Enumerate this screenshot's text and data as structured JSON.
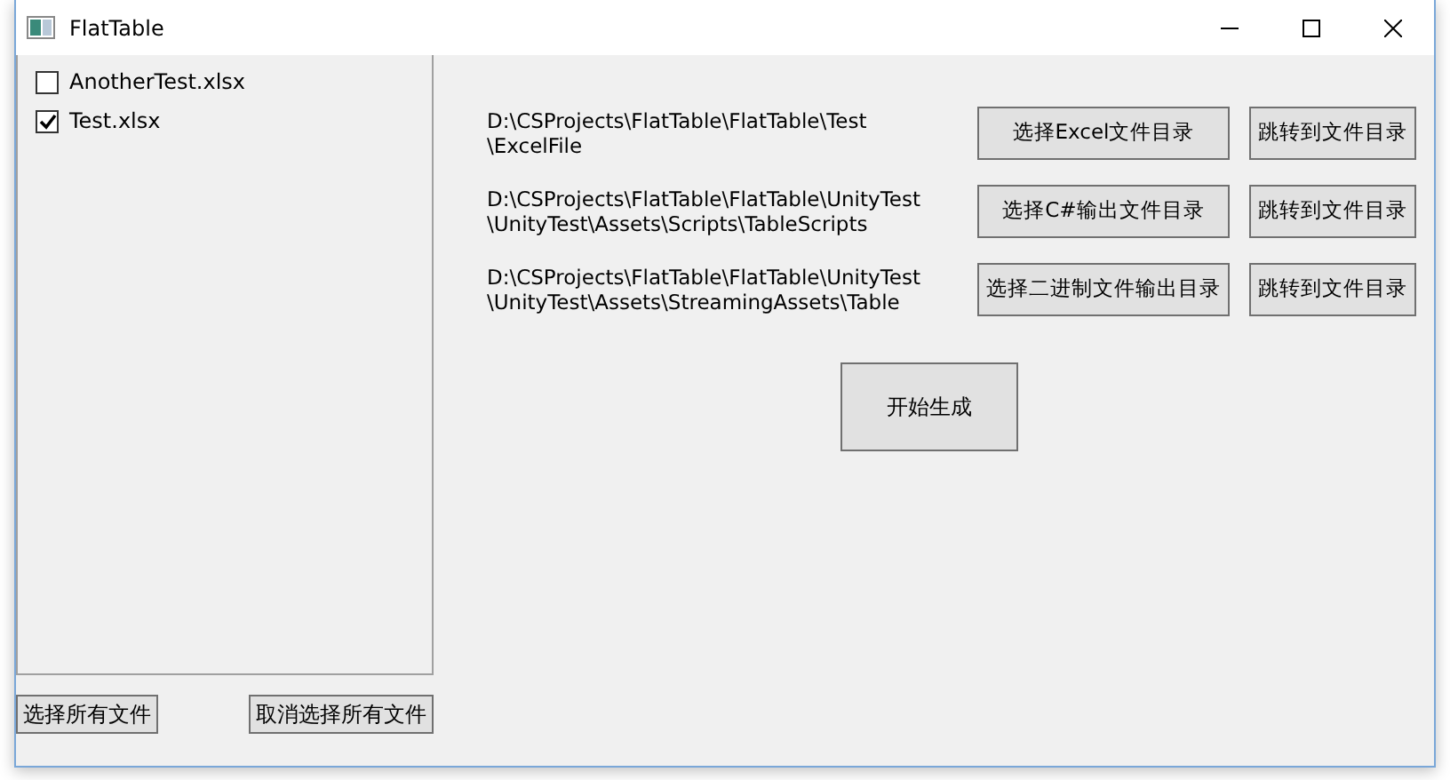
{
  "window": {
    "title": "FlatTable"
  },
  "files": [
    {
      "name": "AnotherTest.xlsx",
      "checked": false
    },
    {
      "name": "Test.xlsx",
      "checked": true
    }
  ],
  "file_buttons": [
    "选择所有文件",
    "取消选择所有文件"
  ],
  "directories": [
    {
      "path": "D:\\CSProjects\\FlatTable\\FlatTable\\Test\n\\ExcelFile",
      "choose": "选择Excel文件目录",
      "open": "跳转到文件目录"
    },
    {
      "path": "D:\\CSProjects\\FlatTable\\FlatTable\\UnityTest\n\\UnityTest\\Assets\\Scripts\\TableScripts",
      "choose": "选择C#输出文件目录",
      "open": "跳转到文件目录"
    },
    {
      "path": "D:\\CSProjects\\FlatTable\\FlatTable\\UnityTest\n\\UnityTest\\Assets\\StreamingAssets\\Table",
      "choose": "选择二进制文件输出目录",
      "open": "跳转到文件目录"
    }
  ],
  "generate_button": "开始生成"
}
